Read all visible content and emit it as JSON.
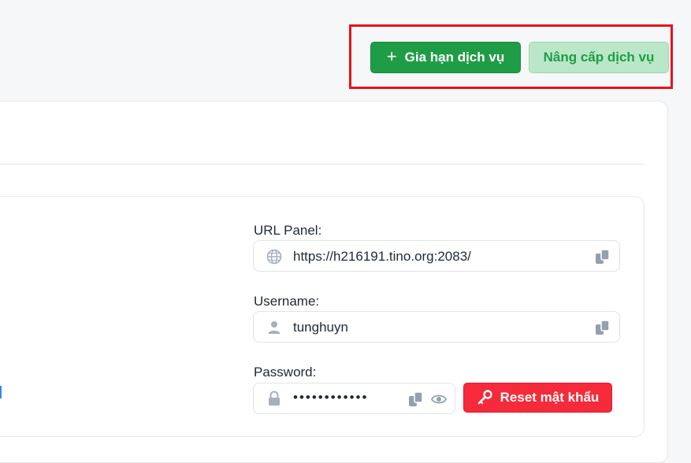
{
  "actions": {
    "renew_label": "Gia hạn dịch vụ",
    "upgrade_label": "Nâng cấp dịch vụ",
    "plus": "+"
  },
  "credentials": {
    "url_label": "URL Panel:",
    "url_value": "https://h216191.tino.org:2083/",
    "username_label": "Username:",
    "username_value": "tunghuyn",
    "password_label": "Password:",
    "password_value": "••••••••••••",
    "reset_label": "Reset mật khẩu"
  },
  "icons": {
    "url": "globe-icon",
    "username": "user-icon",
    "password": "lock-icon",
    "copy": "copy-icon",
    "show": "eye-icon",
    "reset": "key-icon"
  },
  "colors": {
    "green": "#1f9d46",
    "green_light": "#b9e7c7",
    "red": "#f52a3a",
    "highlight": "#e6131b"
  }
}
